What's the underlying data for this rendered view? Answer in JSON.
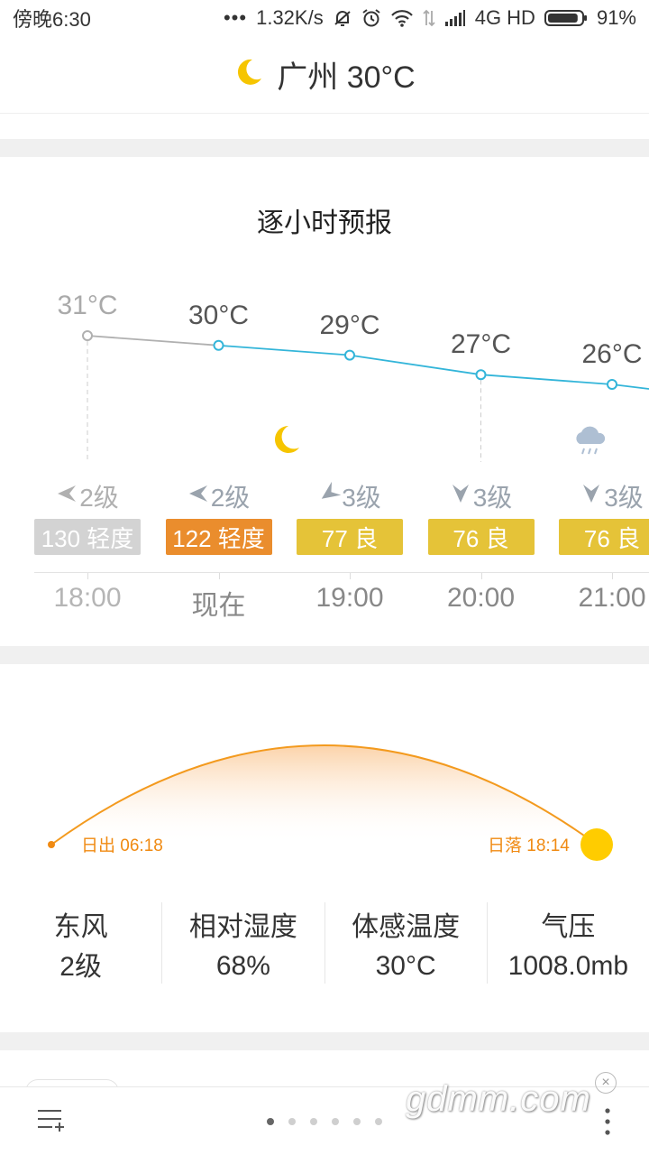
{
  "status_bar": {
    "time": "傍晚6:30",
    "net_speed": "1.32K/s",
    "network": "4G HD",
    "battery": "91%",
    "battery_level": 0.91
  },
  "header": {
    "title": "广州 30°C",
    "icon": "moon-icon"
  },
  "hourly": {
    "title": "逐小时预报",
    "items": [
      {
        "time": "18:00",
        "temp": "31°C",
        "temp_value": 31,
        "wind": "2级",
        "wind_dir": "east",
        "aqi": "130 轻度",
        "aqi_color": "#d3d3d3",
        "past": true,
        "icon": ""
      },
      {
        "time": "现在",
        "temp": "30°C",
        "temp_value": 30,
        "wind": "2级",
        "wind_dir": "east",
        "aqi": "122 轻度",
        "aqi_color": "#ea8d2d",
        "past": false,
        "icon": ""
      },
      {
        "time": "19:00",
        "temp": "29°C",
        "temp_value": 29,
        "wind": "3级",
        "wind_dir": "southeast",
        "aqi": "77 良",
        "aqi_color": "#e5c338",
        "past": false,
        "icon": "moon-icon"
      },
      {
        "time": "20:00",
        "temp": "27°C",
        "temp_value": 27,
        "wind": "3级",
        "wind_dir": "south",
        "aqi": "76 良",
        "aqi_color": "#e5c338",
        "past": false,
        "icon": ""
      },
      {
        "time": "21:00",
        "temp": "26°C",
        "temp_value": 26,
        "wind": "3级",
        "wind_dir": "south",
        "aqi": "76 良",
        "aqi_color": "#e5c338",
        "past": false,
        "icon": "cloud-rain-icon"
      }
    ]
  },
  "sun": {
    "sunrise": "日出 06:18",
    "sunset": "日落 18:14"
  },
  "stats": [
    {
      "label": "东风",
      "value": "2级"
    },
    {
      "label": "相对湿度",
      "value": "68%"
    },
    {
      "label": "体感温度",
      "value": "30°C"
    },
    {
      "label": "气压",
      "value": "1008.0mb"
    }
  ],
  "bottom": {
    "page_count": 6,
    "active_page": 0,
    "watermark": "gdmm.com",
    "close": "×"
  },
  "colors": {
    "line_active": "#33b5d9",
    "line_past": "#b0b0b0",
    "sun_arc": "#f39a1e",
    "sun": "#ffcc00",
    "moon": "#f6c500"
  }
}
